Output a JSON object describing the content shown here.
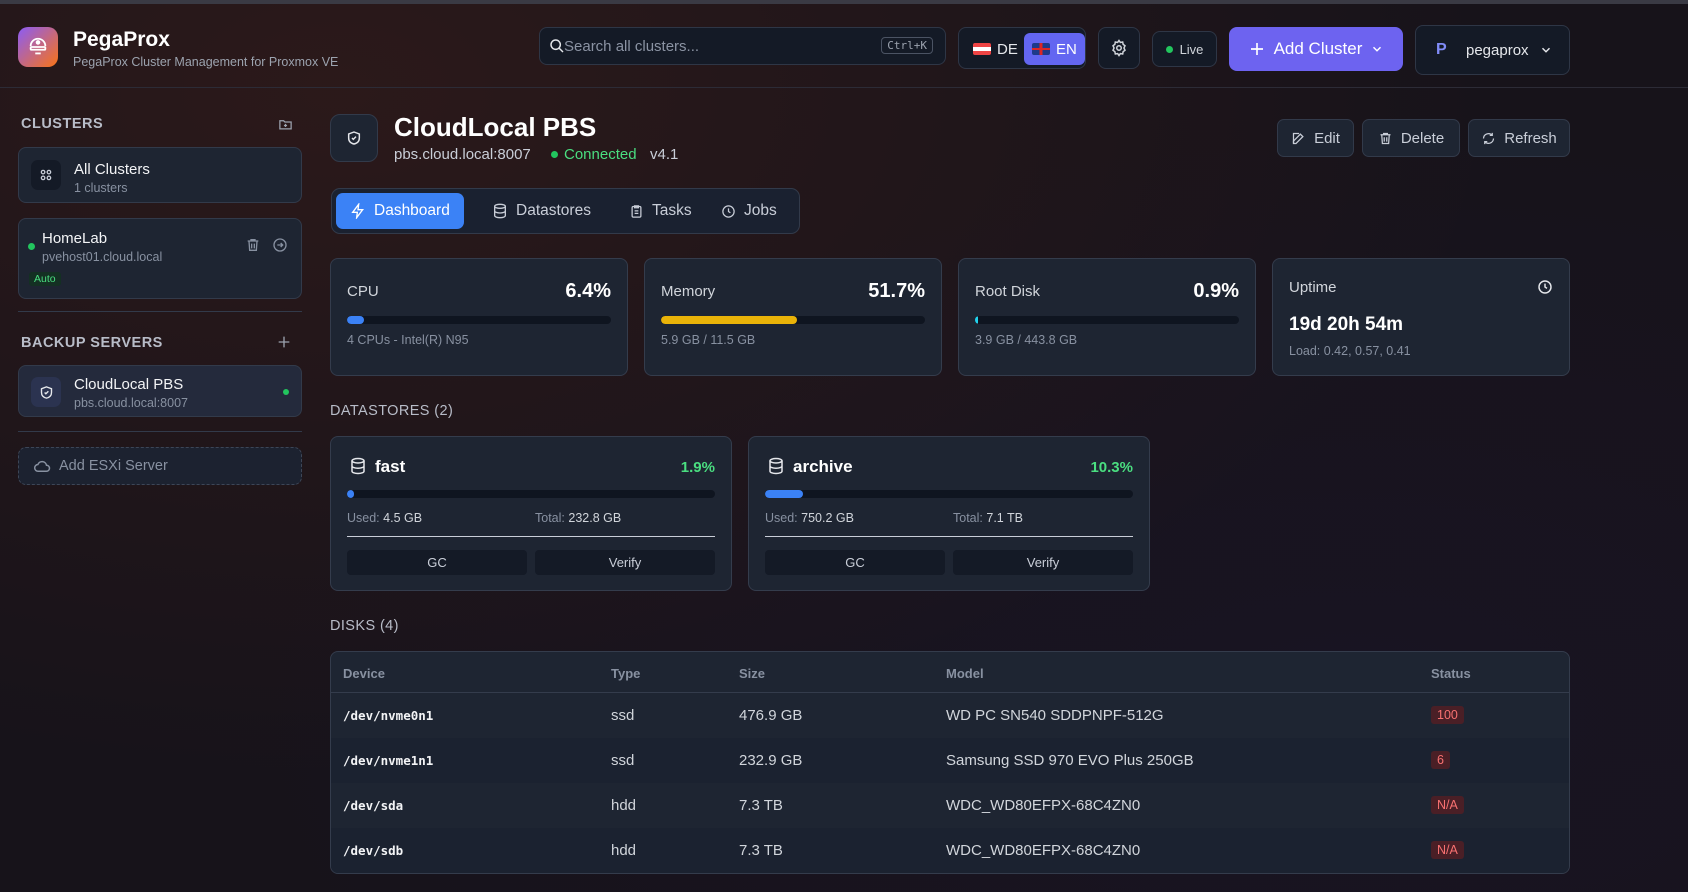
{
  "app": {
    "title": "PegaProx",
    "subtitle": "PegaProx Cluster Management for Proxmox VE"
  },
  "header": {
    "search_placeholder": "Search all clusters...",
    "search_shortcut": "Ctrl+K",
    "lang_de": "DE",
    "lang_en": "EN",
    "active_lang": "EN",
    "live_label": "Live",
    "add_cluster_label": "Add Cluster",
    "user_initial": "P",
    "user_name": "pegaprox"
  },
  "sidebar": {
    "clusters_heading": "CLUSTERS",
    "all_clusters": {
      "title": "All Clusters",
      "sub": "1 clusters"
    },
    "clusters": [
      {
        "name": "HomeLab",
        "host": "pvehost01.cloud.local",
        "badge": "Auto",
        "status_color": "#22c55e"
      }
    ],
    "backup_heading": "BACKUP SERVERS",
    "backup_servers": [
      {
        "name": "CloudLocal PBS",
        "host": "pbs.cloud.local:8007",
        "status_color": "#22c55e"
      }
    ],
    "add_esxi_label": "Add ESXi Server"
  },
  "server": {
    "name": "CloudLocal PBS",
    "host": "pbs.cloud.local:8007",
    "status": "Connected",
    "version": "v4.1"
  },
  "actions": {
    "edit": "Edit",
    "delete": "Delete",
    "refresh": "Refresh"
  },
  "tabs": [
    {
      "label": "Dashboard",
      "active": true
    },
    {
      "label": "Datastores",
      "active": false
    },
    {
      "label": "Tasks",
      "active": false
    },
    {
      "label": "Jobs",
      "active": false
    }
  ],
  "stats": {
    "cpu": {
      "label": "CPU",
      "value": "6.4%",
      "percent": 6.4,
      "sub": "4 CPUs - Intel(R) N95",
      "color": "#3b82f6"
    },
    "memory": {
      "label": "Memory",
      "value": "51.7%",
      "percent": 51.7,
      "sub": "5.9 GB / 11.5 GB",
      "color": "#eab308"
    },
    "root_disk": {
      "label": "Root Disk",
      "value": "0.9%",
      "percent": 0.9,
      "sub": "3.9 GB / 443.8 GB",
      "color": "#22d3ee"
    },
    "uptime": {
      "label": "Uptime",
      "value": "19d 20h 54m",
      "sub": "Load: 0.42, 0.57, 0.41"
    }
  },
  "datastores_heading": "DATASTORES (2)",
  "datastores": [
    {
      "name": "fast",
      "percent_label": "1.9%",
      "percent": 1.9,
      "used_label": "Used:",
      "used": "4.5 GB",
      "total_label": "Total:",
      "total": "232.8 GB",
      "gc_label": "GC",
      "verify_label": "Verify"
    },
    {
      "name": "archive",
      "percent_label": "10.3%",
      "percent": 10.3,
      "used_label": "Used:",
      "used": "750.2 GB",
      "total_label": "Total:",
      "total": "7.1 TB",
      "gc_label": "GC",
      "verify_label": "Verify"
    }
  ],
  "disks_heading": "DISKS (4)",
  "disks": {
    "columns": [
      "Device",
      "Type",
      "Size",
      "Model",
      "Status"
    ],
    "rows": [
      {
        "device": "/dev/nvme0n1",
        "type": "ssd",
        "size": "476.9 GB",
        "model": "WD PC SN540 SDDPNPF-512G",
        "status": "100"
      },
      {
        "device": "/dev/nvme1n1",
        "type": "ssd",
        "size": "232.9 GB",
        "model": "Samsung SSD 970 EVO Plus 250GB",
        "status": "6"
      },
      {
        "device": "/dev/sda",
        "type": "hdd",
        "size": "7.3 TB",
        "model": "WDC_WD80EFPX-68C4ZN0",
        "status": "N/A"
      },
      {
        "device": "/dev/sdb",
        "type": "hdd",
        "size": "7.3 TB",
        "model": "WDC_WD80EFPX-68C4ZN0",
        "status": "N/A"
      }
    ]
  }
}
